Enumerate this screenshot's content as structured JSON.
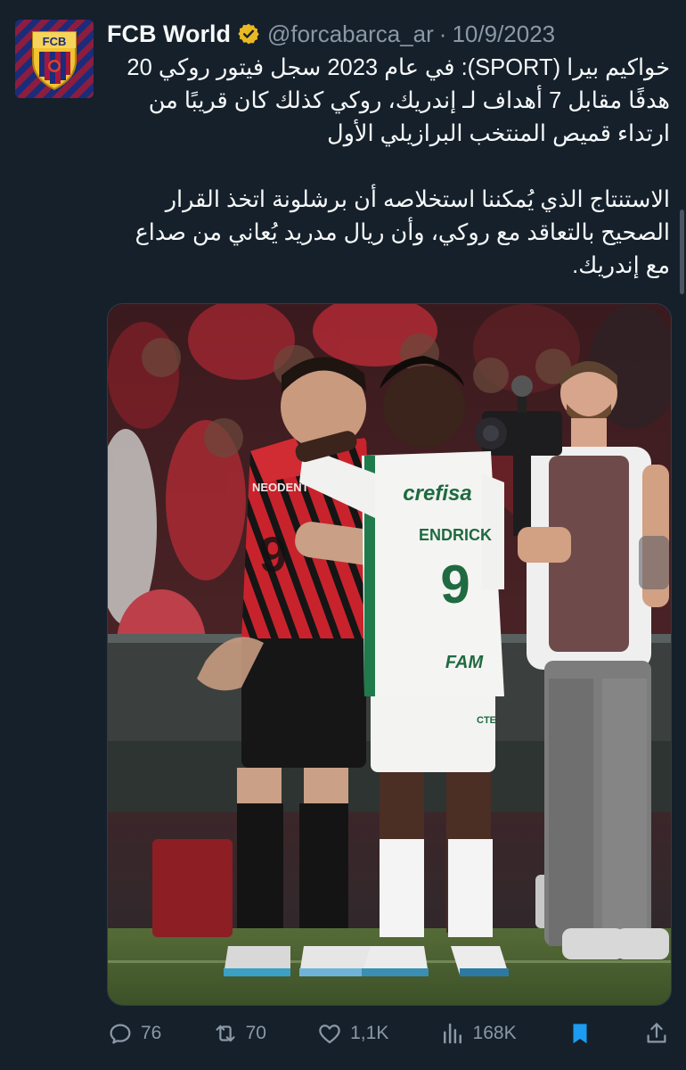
{
  "tweet": {
    "display_name": "FCB World",
    "handle": "@forcabarca_ar",
    "separator": "·",
    "date": "10/9/2023",
    "avatar_text": "FCB",
    "paragraph_1": "خواكيم بيرا (SPORT): في عام 2023 سجل فيتور روكي 20 هدفًا مقابل 7 أهداف لـ إندريك، روكي كذلك كان قريبًا من ارتداء قميص المنتخب البرازيلي الأول",
    "paragraph_2": "الاستنتاج الذي يُمكننا استخلاصه أن برشلونة اتخذ القرار الصحيح بالتعاقد مع روكي، وأن ريال مدريد يُعاني من صداع مع إندريك.",
    "media": {
      "jersey_red_sponsor": "NEODENT",
      "jersey_white_sponsor": "crefisa",
      "jersey_white_name": "ENDRICK",
      "jersey_white_number": "9",
      "jersey_red_number": "9",
      "shorts_sponsor": "FAM",
      "shorts_sponsor_white": "FAM",
      "shorts_sponsor_small": "CTE"
    }
  },
  "actions": {
    "replies": "76",
    "retweets": "70",
    "likes": "1,1K",
    "views": "168K"
  },
  "colors": {
    "background": "#15202b",
    "text_primary": "#f7f9f9",
    "text_secondary": "#8b98a5",
    "bookmark_active": "#1d9bf0",
    "verified_gold": "#e8b923"
  }
}
